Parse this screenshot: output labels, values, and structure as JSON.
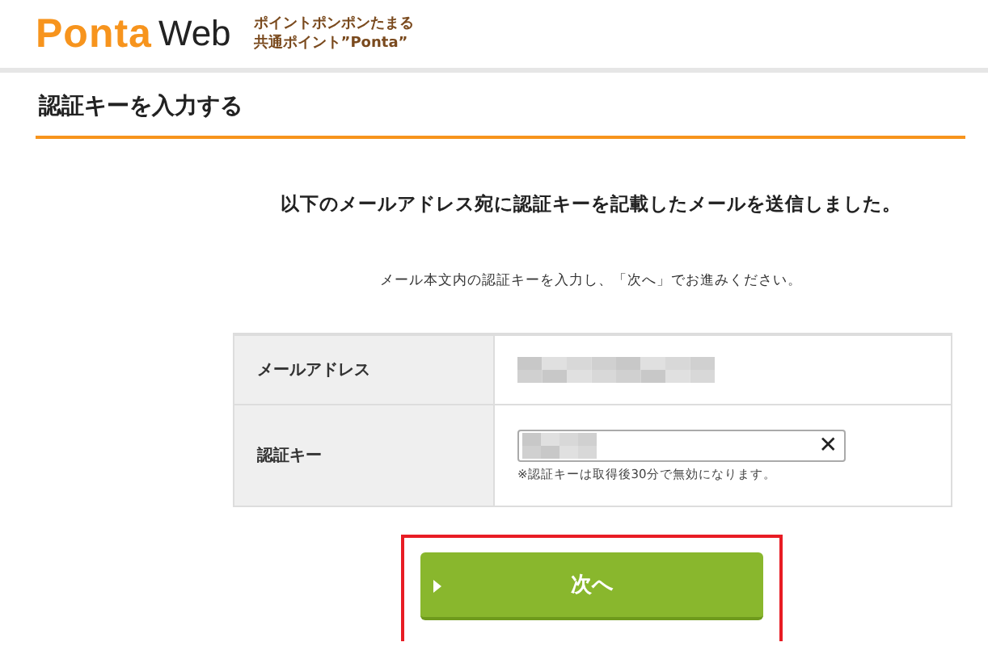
{
  "header": {
    "logo": "Ponta",
    "logo_suffix": "Web",
    "tagline": [
      "ポイントポンポンたまる",
      "共通ポイント”Ponta”"
    ]
  },
  "page_title": "認証キーを入力する",
  "heading": "以下のメールアドレス宛に認証キーを記載したメールを送信しました。",
  "instruction": "メール本文内の認証キーを入力し、「次へ」でお進みください。",
  "form": {
    "rows": [
      {
        "label": "メールアドレス",
        "kind": "readonly"
      },
      {
        "label": "認証キー",
        "kind": "input",
        "clear": "✕",
        "note": "※認証キーは取得後30分で無効になります。"
      }
    ]
  },
  "next_button": {
    "label": "次へ",
    "highlighted": true
  }
}
